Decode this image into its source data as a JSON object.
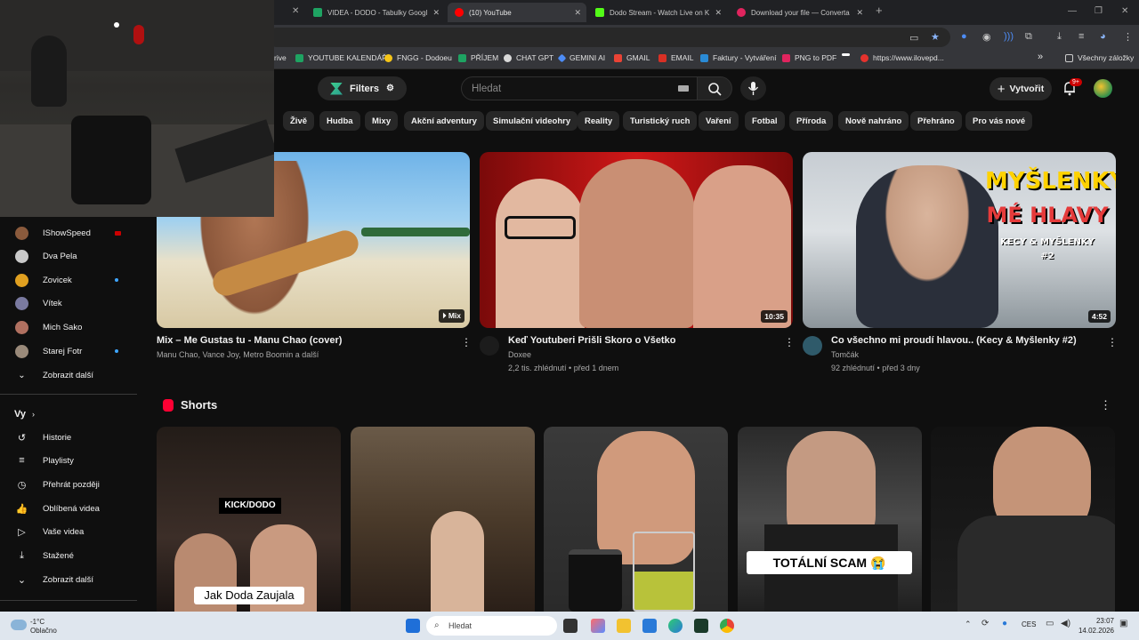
{
  "browser": {
    "tabs": [
      {
        "title": "VIDEA - DODO - Tabulky Googl",
        "active": false,
        "color": "#1ea362"
      },
      {
        "title": "(10) YouTube",
        "active": true,
        "color": "#ff0000"
      },
      {
        "title": "Dodo Stream - Watch Live on K",
        "active": false,
        "color": "#53fc18"
      },
      {
        "title": "Download your file — Converta",
        "active": false,
        "color": "#e0245e"
      }
    ],
    "new_tab": "+",
    "bookmarks": [
      {
        "label": "rive",
        "color": "#888888"
      },
      {
        "label": "YOUTUBE KALENDÁŘ",
        "color": "#1ea362"
      },
      {
        "label": "FNGG - Dodoeu",
        "color": "#f5c518"
      },
      {
        "label": "PŘÍJEM",
        "color": "#1ea362"
      },
      {
        "label": "CHAT GPT",
        "color": "#d9d9d9"
      },
      {
        "label": "GEMINI AI",
        "color": "#4d8cf5"
      },
      {
        "label": "GMAIL",
        "color": "#ea4335"
      },
      {
        "label": "EMAIL",
        "color": "#d93025"
      },
      {
        "label": "Faktury - Vytváření",
        "color": "#2a8bd6"
      },
      {
        "label": "PNG to PDF",
        "color": "#e0245e"
      },
      {
        "label": "",
        "color": "#ffffff"
      },
      {
        "label": "https://www.ilovepd...",
        "color": "#e5322d"
      }
    ],
    "bookmarks_more": "»",
    "all_bookmarks": "Všechny záložky"
  },
  "youtube": {
    "filters_label": "Filters",
    "search_placeholder": "Hledat",
    "create_label": "Vytvořit",
    "notif_badge": "9+",
    "chips": [
      "Živě",
      "Hudba",
      "Mixy",
      "Akční adventury",
      "Simulační videohry",
      "Reality",
      "Turistický ruch",
      "Vaření",
      "Fotbal",
      "Příroda",
      "Nově nahráno",
      "Přehráno",
      "Pro vás nové"
    ],
    "sidebar": {
      "subscriptions": [
        {
          "name": "IShowSpeed",
          "color": "#8a5a3c",
          "live": true
        },
        {
          "name": "Dva Pela",
          "color": "#c9c9c9",
          "live": false
        },
        {
          "name": "Zovicek",
          "color": "#e0a020",
          "live": true
        },
        {
          "name": "Vítek",
          "color": "#7a7aa0",
          "live": false
        },
        {
          "name": "Mich Sako",
          "color": "#b07060",
          "live": false
        },
        {
          "name": "Starej Fotr",
          "color": "#9a8a7a",
          "live": true
        }
      ],
      "show_more_1": "Zobrazit další",
      "you_heading": "Vy",
      "you_items": [
        "Historie",
        "Playlisty",
        "Přehrát později",
        "Oblíbená videa",
        "Vaše videa",
        "Stažené",
        "Zobrazit další"
      ]
    },
    "videos": [
      {
        "title": "Mix – Me Gustas tu - Manu Chao (cover)",
        "meta1": "Manu Chao, Vance Joy, Metro Boomin a další",
        "meta2": "",
        "badge": "Mix"
      },
      {
        "title": "Keď Youtuberi Prišli Skoro o Všetko",
        "meta1": "Doxee",
        "meta2": "2,2 tis. zhlédnutí • před 1 dnem",
        "badge": "10:35"
      },
      {
        "title": "Co všechno mi proudí hlavou.. (Kecy & Myšlenky #2)",
        "meta1": "Tomčák",
        "meta2": "92 zhlédnutí • před 3 dny",
        "badge": "4:52"
      }
    ],
    "thumb_texts": {
      "line1": "MYŠLENKY",
      "line2": "MÉ HLAVY",
      "line3": "KECY & MYŠLENKY",
      "line4": "#2"
    },
    "shorts_heading": "Shorts",
    "shorts": [
      {
        "overlay": "Jak Doda Zaujala",
        "overlay2": "Kick/Dodo"
      },
      {
        "overlay": ""
      },
      {
        "overlay": ""
      },
      {
        "overlay": "TOTÁLNÍ SCAM 😭"
      },
      {
        "overlay": ""
      }
    ]
  },
  "taskbar": {
    "weather_temp": "-1°C",
    "weather_desc": "Oblačno",
    "search_placeholder": "Hledat",
    "lang": "CES",
    "time": "23:07",
    "date": "14.02.2026"
  }
}
